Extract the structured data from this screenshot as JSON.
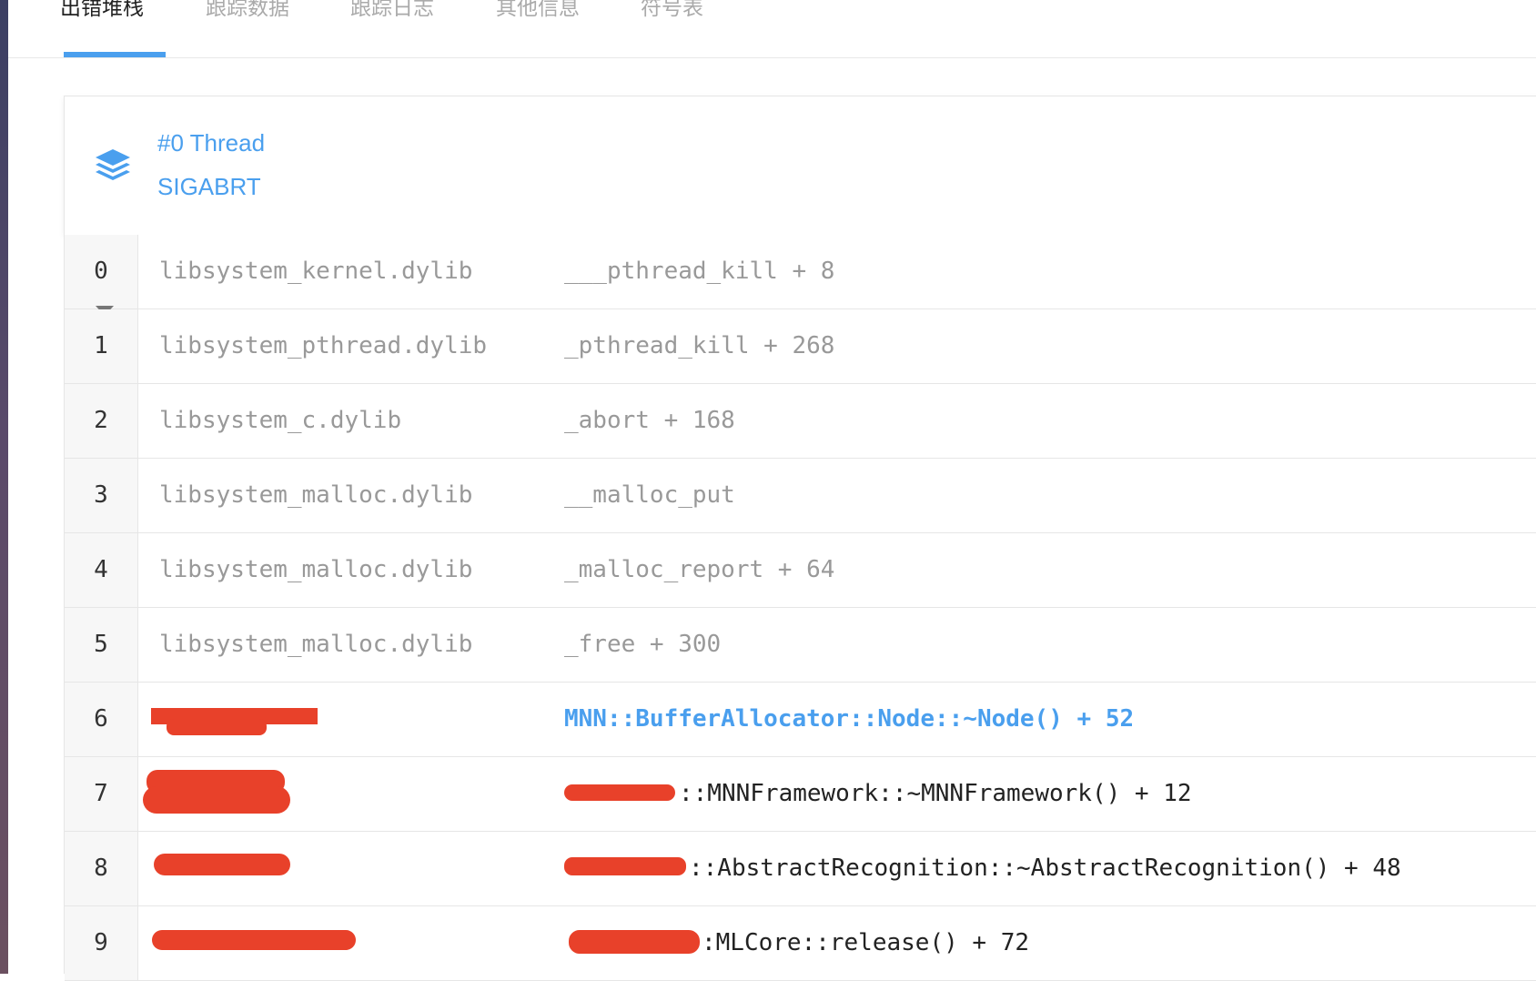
{
  "tabs": [
    {
      "label": "出错堆栈",
      "active": true
    },
    {
      "label": "跟踪数据",
      "active": false
    },
    {
      "label": "跟踪日志",
      "active": false
    },
    {
      "label": "其他信息",
      "active": false
    },
    {
      "label": "符号表",
      "active": false
    }
  ],
  "thread": {
    "title": "#0 Thread",
    "signal": "SIGABRT",
    "icon": "layers-icon"
  },
  "frames": [
    {
      "index": "0",
      "library": "libsystem_kernel.dylib",
      "symbol": "___pthread_kill + 8"
    },
    {
      "index": "1",
      "library": "libsystem_pthread.dylib",
      "symbol": "_pthread_kill + 268"
    },
    {
      "index": "2",
      "library": "libsystem_c.dylib",
      "symbol": "_abort + 168"
    },
    {
      "index": "3",
      "library": "libsystem_malloc.dylib",
      "symbol": "__malloc_put"
    },
    {
      "index": "4",
      "library": "libsystem_malloc.dylib",
      "symbol": "_malloc_report + 64"
    },
    {
      "index": "5",
      "library": "libsystem_malloc.dylib",
      "symbol": "_free + 300"
    },
    {
      "index": "6",
      "library": "",
      "symbol": "MNN::BufferAllocator::Node::~Node() + 52"
    },
    {
      "index": "7",
      "library": "",
      "symbol": "::MNNFramework::~MNNFramework() + 12"
    },
    {
      "index": "8",
      "library": "",
      "symbol": "::AbstractRecognition::~AbstractRecognition() + 48"
    },
    {
      "index": "9",
      "library": "",
      "symbol": ":MLCore::release() + 72"
    }
  ],
  "colors": {
    "accent": "#4a9fee",
    "redaction": "#e8412a",
    "muted_text": "#999999"
  }
}
